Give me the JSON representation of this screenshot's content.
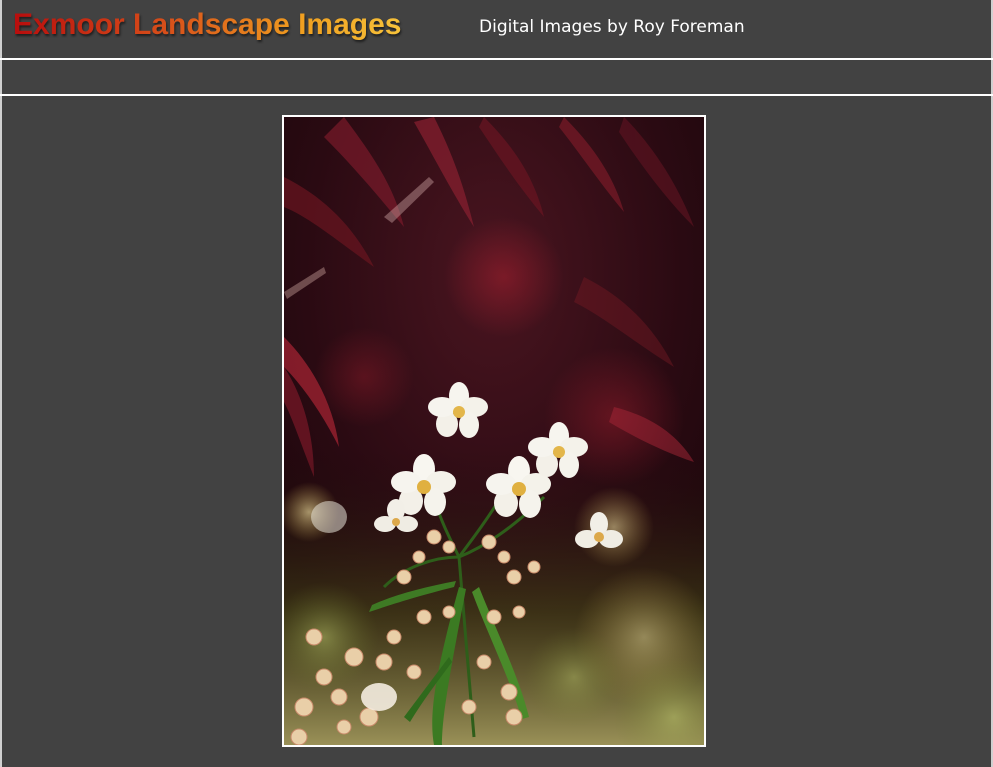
{
  "header": {
    "title": "Exmoor Landscape Images",
    "subtitle": "Digital Images by Roy Foreman"
  },
  "colors": {
    "background": "#424242",
    "rule": "#ffffff",
    "title_gradient_start": "#b80d0d",
    "title_gradient_end": "#f7c23a",
    "subtitle": "#ffffff"
  },
  "main": {
    "photo": {
      "subject": "photo-white-blossom"
    }
  }
}
